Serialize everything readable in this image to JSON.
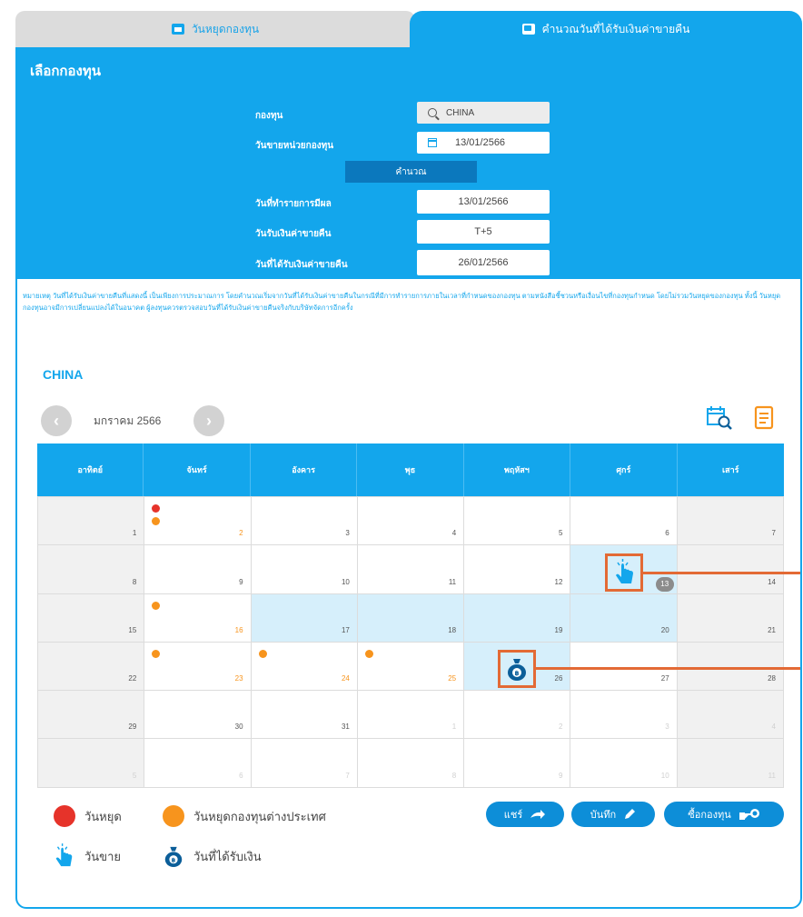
{
  "tabs": {
    "left_label": "วันหยุดกองทุน",
    "right_label": "คำนวณวันที่ได้รับเงินค่าขายคืน"
  },
  "form": {
    "title": "เลือกกองทุน",
    "fund_label": "กองทุน",
    "fund_value": "CHINA",
    "sell_date_label": "วันขายหน่วยกองทุน",
    "sell_date_value": "13/01/2566",
    "calc_button": "คำนวณ",
    "order_date_label": "วันที่ทำรายการมีผล",
    "order_date_value": "13/01/2566",
    "receive_label": "วันรับเงินค่าขายคืน",
    "receive_value": "T+5",
    "receive_date_label": "วันที่ได้รับเงินค่าขายคืน",
    "receive_date_value": "26/01/2566"
  },
  "note": "หมายเหตุ วันที่ได้รับเงินค่าขายคืนที่แสดงนี้ เป็นเพียงการประมาณการ โดยคำนวณเริ่มจากวันที่ได้รับเงินค่าขายคืนในกรณีที่มีการทำรายการภายในเวลาที่กำหนดของกองทุน ตามหนังสือชี้ชวนหรือเงื่อนไขที่กองทุนกำหนด โดยไม่รวมวันหยุดของกองทุน ทั้งนี้ วันหยุดกองทุนอาจมีการเปลี่ยนแปลงได้ในอนาคต ผู้ลงทุนควรตรวจสอบวันที่ได้รับเงินค่าขายคืนจริงกับบริษัทจัดการอีกครั้ง",
  "calendar": {
    "fund_name": "CHINA",
    "month_label": "มกราคม 2566",
    "weekdays": [
      "อาทิตย์",
      "จันทร์",
      "อังคาร",
      "พุธ",
      "พฤหัสฯ",
      "ศุกร์",
      "เสาร์"
    ],
    "days": [
      {
        "n": "1",
        "t": "weekend"
      },
      {
        "n": "2",
        "t": "holiday"
      },
      {
        "n": "3",
        "t": ""
      },
      {
        "n": "4",
        "t": ""
      },
      {
        "n": "5",
        "t": ""
      },
      {
        "n": "6",
        "t": ""
      },
      {
        "n": "7",
        "t": "weekend"
      },
      {
        "n": "8",
        "t": "weekend"
      },
      {
        "n": "9",
        "t": ""
      },
      {
        "n": "10",
        "t": ""
      },
      {
        "n": "11",
        "t": ""
      },
      {
        "n": "12",
        "t": ""
      },
      {
        "n": "13",
        "t": "sell"
      },
      {
        "n": "14",
        "t": "weekend"
      },
      {
        "n": "15",
        "t": "weekend"
      },
      {
        "n": "16",
        "t": "foreign"
      },
      {
        "n": "17",
        "t": "hl"
      },
      {
        "n": "18",
        "t": "hl"
      },
      {
        "n": "19",
        "t": "hl"
      },
      {
        "n": "20",
        "t": "hl"
      },
      {
        "n": "21",
        "t": "weekend"
      },
      {
        "n": "22",
        "t": "weekend"
      },
      {
        "n": "23",
        "t": "foreign"
      },
      {
        "n": "24",
        "t": "foreign"
      },
      {
        "n": "25",
        "t": "foreign"
      },
      {
        "n": "26",
        "t": "receive"
      },
      {
        "n": "27",
        "t": ""
      },
      {
        "n": "28",
        "t": "weekend"
      },
      {
        "n": "29",
        "t": "weekend"
      },
      {
        "n": "30",
        "t": ""
      },
      {
        "n": "31",
        "t": ""
      },
      {
        "n": "1",
        "t": "other"
      },
      {
        "n": "2",
        "t": "other"
      },
      {
        "n": "3",
        "t": "other"
      },
      {
        "n": "4",
        "t": "other-weekend"
      },
      {
        "n": "5",
        "t": "other-weekend"
      },
      {
        "n": "6",
        "t": "other"
      },
      {
        "n": "7",
        "t": "other"
      },
      {
        "n": "8",
        "t": "other"
      },
      {
        "n": "9",
        "t": "other"
      },
      {
        "n": "10",
        "t": "other"
      },
      {
        "n": "11",
        "t": "other-weekend"
      }
    ]
  },
  "legend": {
    "holiday": "วันหยุด",
    "foreign_holiday": "วันหยุดกองทุนต่างประเทศ",
    "sell_day": "วันขาย",
    "receive_day": "วันที่ได้รับเงิน"
  },
  "actions": {
    "share": "แชร์",
    "save": "บันทึก",
    "buy": "ซื้อกองทุน"
  },
  "colors": {
    "primary": "#13a6ec",
    "dark_blue": "#0b78bd",
    "holiday_red": "#e6332a",
    "foreign_orange": "#f7941d",
    "marker": "#e36a35"
  }
}
